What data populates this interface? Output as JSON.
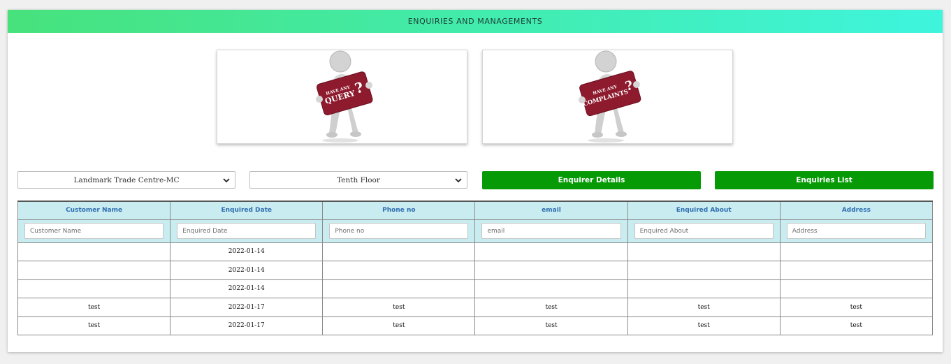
{
  "header": {
    "title": "ENQUIRIES AND MANAGEMENTS"
  },
  "cards": [
    {
      "line1": "HAVE ANY",
      "line2": "QUERY",
      "mark": "?"
    },
    {
      "line1": "HAVE ANY",
      "line2": "COMPLAINTS",
      "mark": "?"
    }
  ],
  "filters": {
    "building": {
      "value": "Landmark Trade Centre-MC"
    },
    "floor": {
      "value": "Tenth Floor"
    }
  },
  "buttons": {
    "enquirer_details": "Enquirer Details",
    "enquiries_list": "Enquiries List"
  },
  "table": {
    "columns": [
      "Customer Name",
      "Enquired Date",
      "Phone no",
      "email",
      "Enquired About",
      "Address"
    ],
    "placeholders": [
      "Customer Name",
      "Enquired Date",
      "Phone no",
      "email",
      "Enquired About",
      "Address"
    ],
    "rows": [
      [
        "",
        "2022-01-14",
        "",
        "",
        "",
        ""
      ],
      [
        "",
        "2022-01-14",
        "",
        "",
        "",
        ""
      ],
      [
        "",
        "2022-01-14",
        "",
        "",
        "",
        ""
      ],
      [
        "test",
        "2022-01-17",
        "test",
        "test",
        "test",
        "test"
      ],
      [
        "test",
        "2022-01-17",
        "test",
        "test",
        "test",
        "test"
      ]
    ]
  },
  "colors": {
    "header_gradient_start": "#47e27c",
    "header_gradient_end": "#3ef5dd",
    "button_green": "#069a06",
    "table_header_bg": "#c8ecef",
    "table_header_text": "#2f6db1",
    "sign_red": "#8e1a2e"
  }
}
